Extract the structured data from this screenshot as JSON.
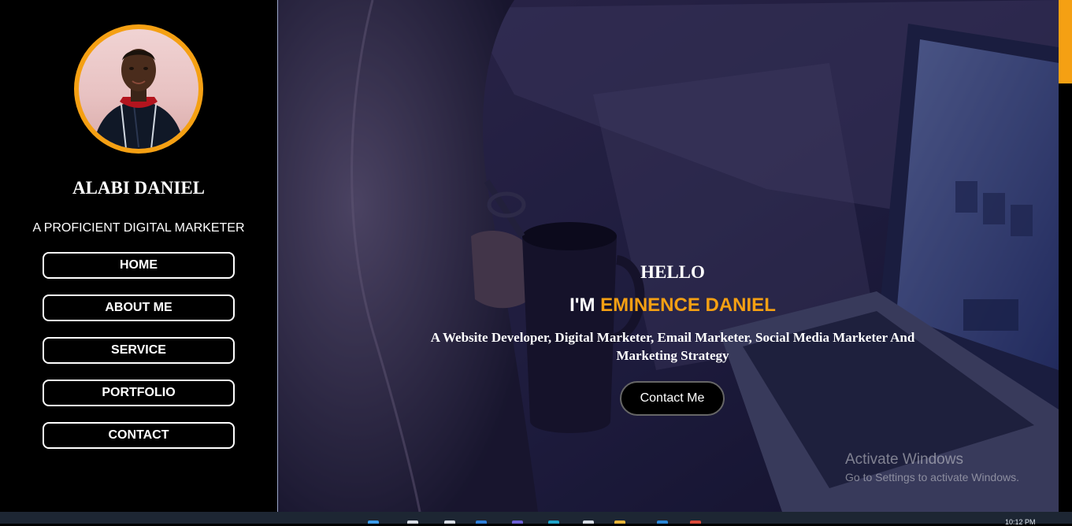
{
  "sidebar": {
    "name": "ALABI DANIEL",
    "tagline": "A PROFICIENT DIGITAL MARKETER",
    "nav": [
      {
        "label": "HOME"
      },
      {
        "label": "ABOUT ME"
      },
      {
        "label": "SERVICE"
      },
      {
        "label": "PORTFOLIO"
      },
      {
        "label": "CONTACT"
      }
    ]
  },
  "hero": {
    "greeting": "HELLO",
    "intro_prefix": "I'M",
    "intro_name": "EMINENCE DANIEL",
    "description": "A Website Developer, Digital Marketer, Email Marketer, Social Media Marketer And Marketing Strategy",
    "cta_label": "Contact Me"
  },
  "watermark": {
    "title": "Activate Windows",
    "subtitle": "Go to Settings to activate Windows."
  },
  "taskbar": {
    "clock": "10:12 PM",
    "icons": [
      "windows-icon",
      "search-icon",
      "task-view-icon",
      "mail-icon",
      "teams-icon",
      "edge-icon",
      "file-icon",
      "folder-icon",
      "vscode-icon",
      "chrome-icon"
    ]
  },
  "colors": {
    "accent": "#f5a013",
    "background": "#000000",
    "text": "#ffffff"
  }
}
